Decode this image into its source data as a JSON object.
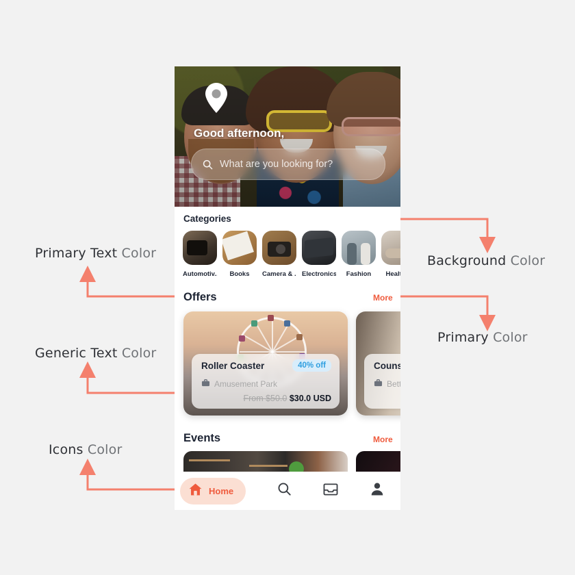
{
  "annotations": [
    {
      "id": "primary-text-color",
      "strong": "Primary Text",
      "soft": "Color"
    },
    {
      "id": "generic-text-color",
      "strong": "Generic Text",
      "soft": "Color"
    },
    {
      "id": "icons-color",
      "strong": "Icons",
      "soft": "Color"
    },
    {
      "id": "background-color",
      "strong": "Background",
      "soft": "Color"
    },
    {
      "id": "primary-color",
      "strong": "Primary",
      "soft": "Color"
    }
  ],
  "colors": {
    "accent": "#ef5b3d",
    "annotation_arrow": "#f4806d",
    "page_background": "#f2f2f2",
    "phone_background": "#ffffff",
    "primary_text": "#1d2433",
    "generic_text": "#a8a8a8",
    "badge_bg": "#d8edfb",
    "badge_text": "#2f9fe0",
    "tab_active_pill": "#fbdfd3"
  },
  "phone": {
    "hero": {
      "location_icon": "location-pin-icon",
      "greeting": "Good afternoon,",
      "search": {
        "icon": "search-icon",
        "placeholder": "What are you looking for?",
        "value": ""
      }
    },
    "categories": {
      "title": "Categories",
      "items": [
        {
          "label": "Automotiv...",
          "thumb": "automotive-thumb"
        },
        {
          "label": "Books",
          "thumb": "books-thumb"
        },
        {
          "label": "Camera & ...",
          "thumb": "camera-thumb"
        },
        {
          "label": "Electronics",
          "thumb": "electronics-thumb"
        },
        {
          "label": "Fashion",
          "thumb": "fashion-thumb"
        },
        {
          "label": "Health a",
          "thumb": "health-thumb"
        }
      ]
    },
    "offers": {
      "title": "Offers",
      "more_label": "More",
      "cards": [
        {
          "title": "Roller Coaster",
          "badge": "40% off",
          "venue_icon": "briefcase-icon",
          "venue": "Amusement Park",
          "price_from": "From $50.0",
          "price_now": "$30.0 USD"
        },
        {
          "title": "Counselling",
          "badge": "",
          "venue_icon": "briefcase-icon",
          "venue": "Better t",
          "price_from": "",
          "price_now": ""
        }
      ]
    },
    "events": {
      "title": "Events",
      "more_label": "More",
      "cards": [
        {
          "thumb": "event-interior-thumb"
        },
        {
          "thumb": "event-dark-thumb"
        }
      ]
    },
    "tabbar": {
      "items": [
        {
          "label": "Home",
          "icon": "home-icon",
          "active": true
        },
        {
          "label": "",
          "icon": "search-icon",
          "active": false
        },
        {
          "label": "",
          "icon": "inbox-icon",
          "active": false
        },
        {
          "label": "",
          "icon": "person-icon",
          "active": false
        }
      ]
    }
  }
}
